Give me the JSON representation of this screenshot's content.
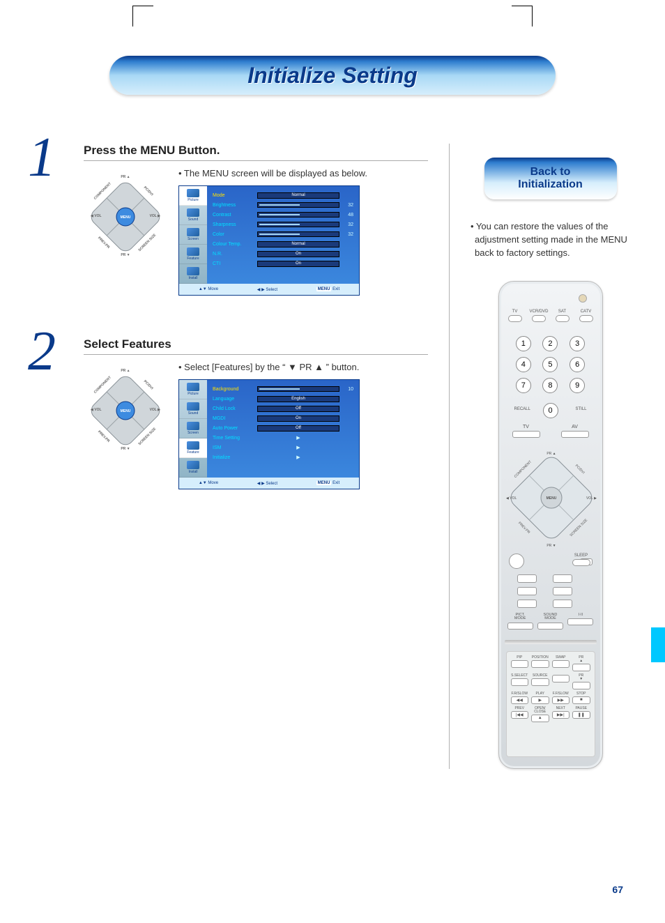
{
  "page": {
    "number": "67",
    "title": "Initialize Setting"
  },
  "back_pill": {
    "line1": "Back to",
    "line2": "Initialization"
  },
  "right_desc": "• You can restore the values of the adjustment setting made in the MENU back to factory settings.",
  "step1": {
    "number": "1",
    "title": "Press the MENU Button.",
    "desc": "• The MENU screen will be displayed as below."
  },
  "step2": {
    "number": "2",
    "title": "Select Features",
    "desc": "• Select [Features] by the “ ▼ PR ▲ ” button."
  },
  "dpad_labels": {
    "top": "PR ▲",
    "bottom": "PR ▼",
    "ul": "COMPONENT",
    "ur": "PC/DVI",
    "ll": "PREV.PR",
    "lr": "SCREEN SIZE",
    "left": "◀ VOL",
    "right": "VOL ▶",
    "center": "MENU"
  },
  "osd1": {
    "tabs": [
      "Picture",
      "Sound",
      "Screen",
      "Feature",
      "Install"
    ],
    "active_tab": 0,
    "rows": [
      {
        "label": "Mode",
        "kind": "pill",
        "value": "Normal",
        "sel": true
      },
      {
        "label": "Brightness",
        "kind": "slider",
        "num": "32"
      },
      {
        "label": "Contrast",
        "kind": "slider",
        "num": "48"
      },
      {
        "label": "Sharpness",
        "kind": "slider",
        "num": "32"
      },
      {
        "label": "Color",
        "kind": "slider",
        "num": "32"
      },
      {
        "label": "Colour Temp.",
        "kind": "pill",
        "value": "Normal"
      },
      {
        "label": "N.R.",
        "kind": "pill",
        "value": "On"
      },
      {
        "label": "CTI",
        "kind": "pill",
        "value": "On"
      }
    ],
    "footer": {
      "move": "Move",
      "select": "Select",
      "exit": "Exit",
      "menu": "MENU"
    }
  },
  "osd2": {
    "tabs": [
      "Picture",
      "Sound",
      "Screen",
      "Feature",
      "Install"
    ],
    "active_tab": 3,
    "rows": [
      {
        "label": "Background",
        "kind": "slider",
        "num": "10",
        "sel": true
      },
      {
        "label": "Language",
        "kind": "pill",
        "value": "English"
      },
      {
        "label": "Child Lock",
        "kind": "pill",
        "value": "Off"
      },
      {
        "label": "MGDI",
        "kind": "pill",
        "value": "On"
      },
      {
        "label": "Auto Power",
        "kind": "pill",
        "value": "Off"
      },
      {
        "label": "Time Setting",
        "kind": "arrow"
      },
      {
        "label": "ISM",
        "kind": "arrow"
      },
      {
        "label": "Initialize",
        "kind": "arrow"
      }
    ],
    "footer": {
      "move": "Move",
      "select": "Select",
      "exit": "Exit",
      "menu": "MENU"
    }
  },
  "remote": {
    "sources": [
      "TV",
      "VCR/DVD",
      "SAT",
      "CATV"
    ],
    "numbers": [
      "1",
      "2",
      "3",
      "4",
      "5",
      "6",
      "7",
      "8",
      "9",
      "0"
    ],
    "recall": "RECALL",
    "still": "STILL",
    "tv": "TV",
    "av": "AV",
    "sleep": "SLEEP",
    "pict_mode": "PICT.\nMODE",
    "sound_mode": "SOUND\nMODE",
    "ii": "I·II",
    "lower": {
      "row1": [
        "PIP",
        "POSITION",
        "SWAP",
        "PR\n▲"
      ],
      "row2": [
        "S.SELECT",
        "SOURCE",
        "",
        "PR\n▼"
      ],
      "row3": [
        "F.R/SLOW",
        "PLAY",
        "F.F/SLOW",
        "STOP"
      ],
      "row3_sym": [
        "◀◀",
        "▶",
        "▶▶",
        "■"
      ],
      "row4": [
        "PREV",
        "OPEN/\nCLOSE",
        "NEXT",
        "PAUSE"
      ],
      "row4_sym": [
        "|◀◀",
        "▲",
        "▶▶|",
        "❚❚"
      ]
    }
  }
}
